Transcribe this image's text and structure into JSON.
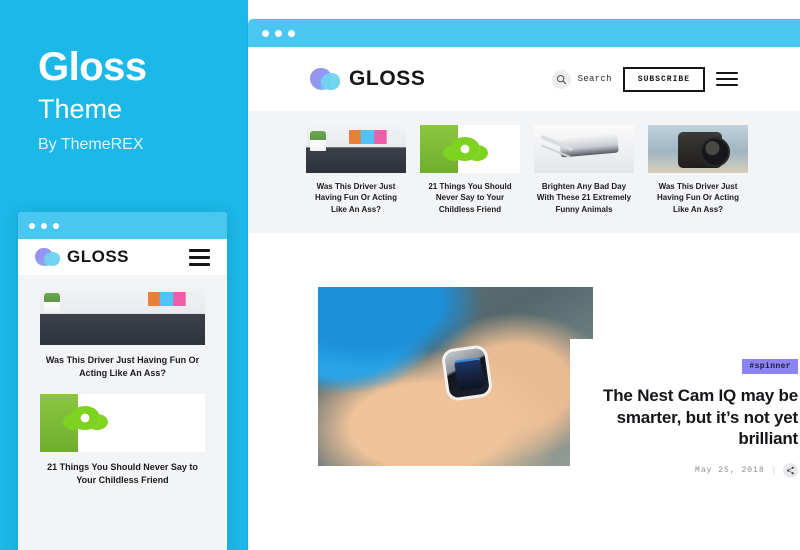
{
  "promo": {
    "title": "Gloss",
    "subtitle": "Theme",
    "byline": "By ThemeREX",
    "background_color": "#1CB8E8"
  },
  "window_chrome": {
    "titlebar_color": "#49C7F0",
    "dot_count": 3
  },
  "desktop": {
    "header": {
      "brand_name": "GLOSS",
      "search_label": "Search",
      "search_icon": "search-icon",
      "subscribe_label": "SUBSCRIBE",
      "menu_icon": "hamburger-menu-icon",
      "logo_icon": "gloss-logo-blob-icon"
    },
    "thumbnails": [
      {
        "title": "Was This Driver Just Having Fun Or Acting Like An Ass?",
        "art": "art-tablet"
      },
      {
        "title": "21 Things You Should Never Say to Your Childless Friend",
        "art": "art-spinner"
      },
      {
        "title": "Brighten Any Bad Day With These 21 Extremely Funny Animals",
        "art": "art-buds"
      },
      {
        "title": "Was This Driver Just Having Fun Or Acting Like An Ass?",
        "art": "art-camera"
      }
    ],
    "hero": {
      "tag": "#spinner",
      "tag_color": "#8B84F2",
      "title": "The Nest Cam IQ may be smarter, but it’s not yet brilliant",
      "date": "May 25, 2018",
      "separator": "|",
      "share_icon": "share-icon",
      "image_alt": "person tapping a smartwatch"
    }
  },
  "mobile": {
    "header": {
      "brand_name": "GLOSS",
      "menu_icon": "hamburger-menu-icon",
      "logo_icon": "gloss-logo-blob-icon"
    },
    "cards": [
      {
        "title": "Was This Driver Just Having Fun Or Acting Like An Ass?",
        "art": "art-tablet"
      },
      {
        "title": "21 Things You Should Never Say to Your Childless Friend",
        "art": "art-spinner"
      }
    ]
  }
}
